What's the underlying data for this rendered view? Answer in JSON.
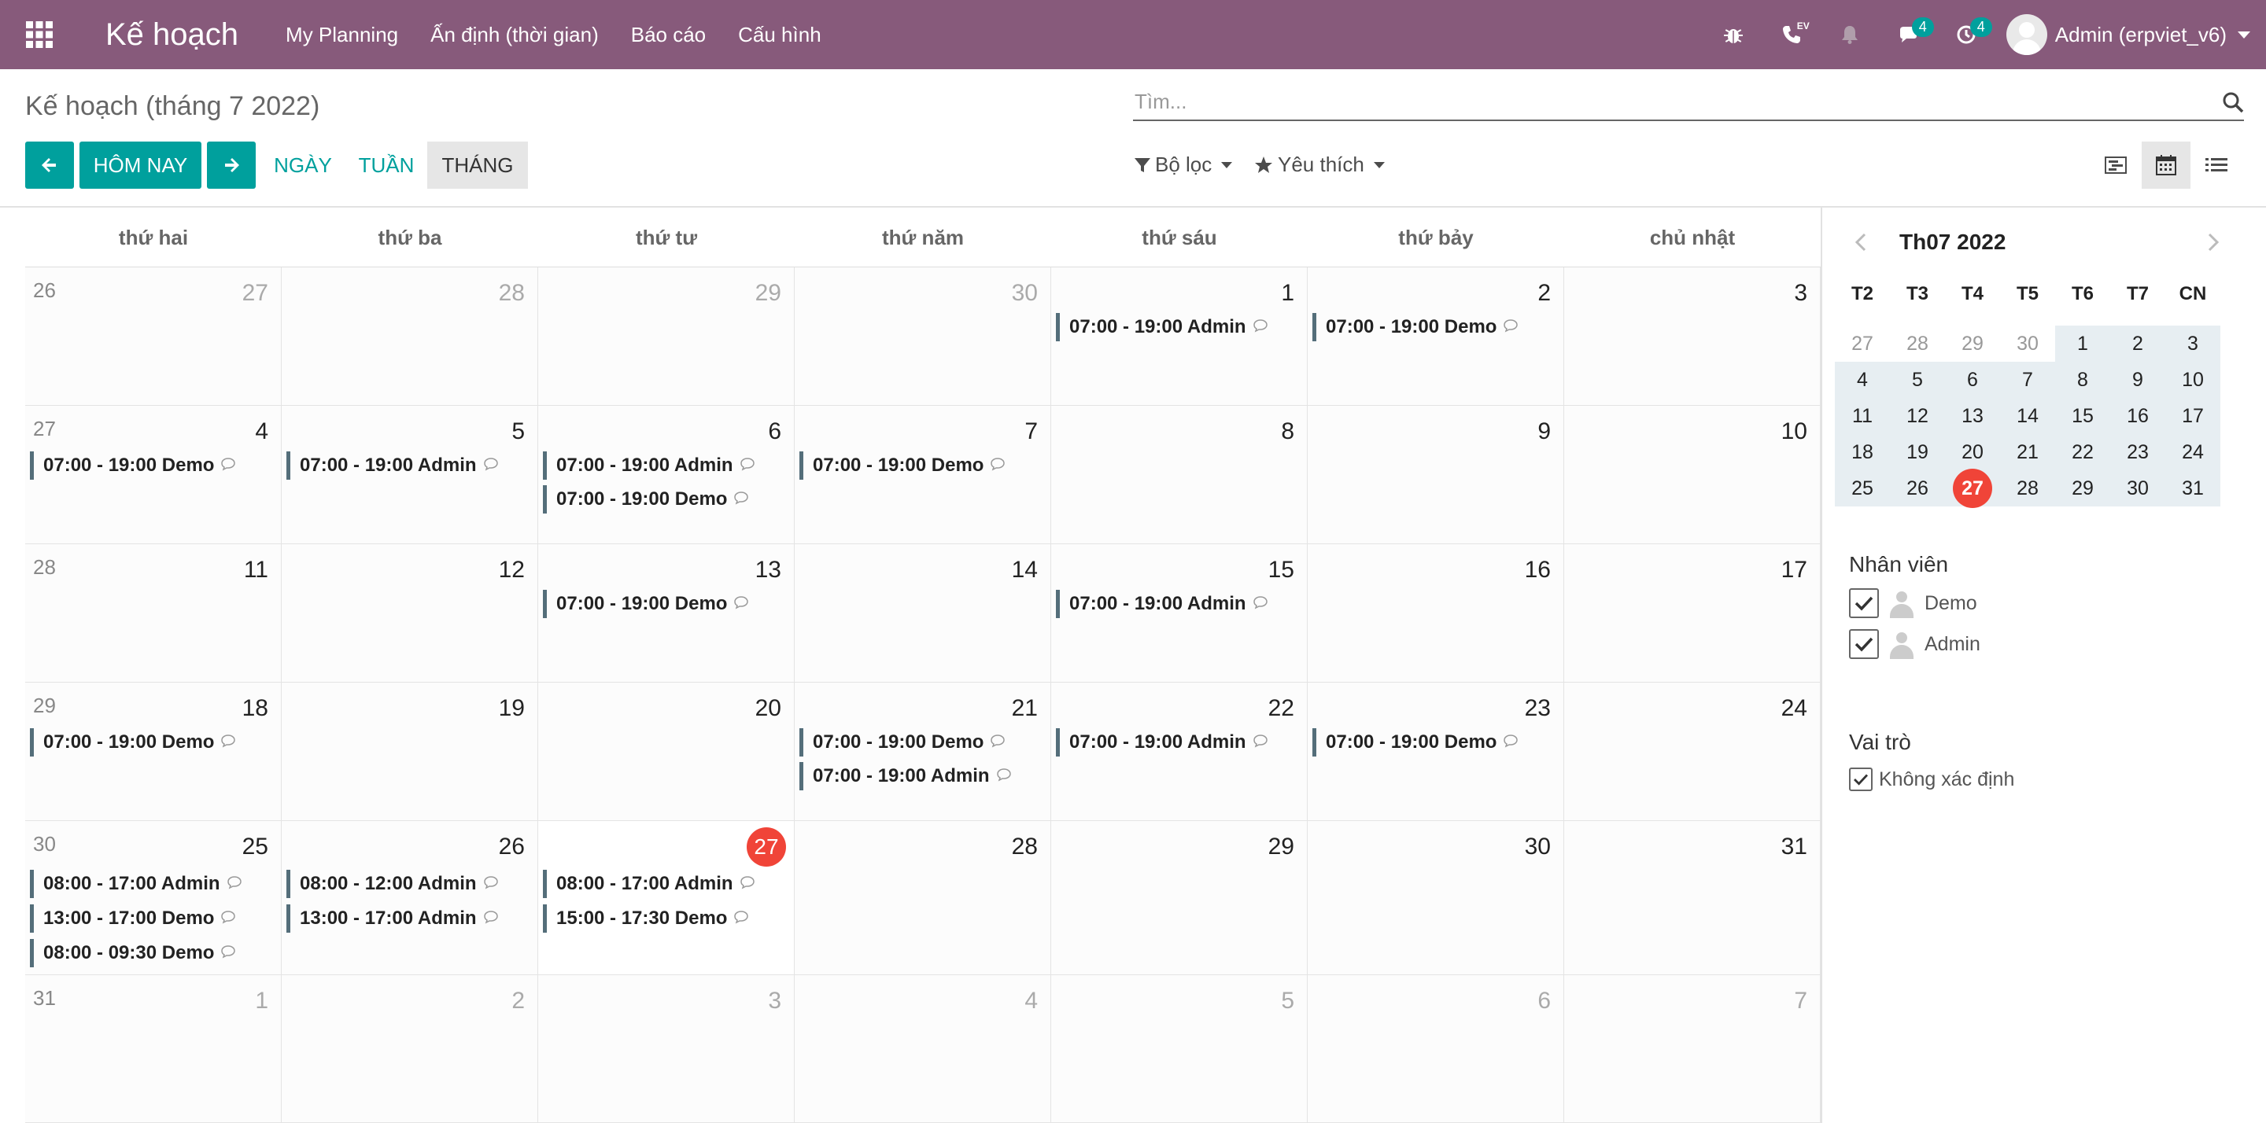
{
  "navbar": {
    "app_title": "Kế hoạch",
    "menu": [
      "My Planning",
      "Ấn định (thời gian)",
      "Báo cáo",
      "Cấu hình"
    ],
    "voip_label": "EV",
    "messages_count": "4",
    "activities_count": "4",
    "user_name": "Admin (erpviet_v6)"
  },
  "control": {
    "breadcrumb": "Kế hoạch (tháng 7 2022)",
    "search_placeholder": "Tìm...",
    "today_label": "HÔM NAY",
    "scale_day": "NGÀY",
    "scale_week": "TUẦN",
    "scale_month": "THÁNG",
    "filters_label": "Bộ lọc",
    "favorites_label": "Yêu thích"
  },
  "calendar": {
    "day_names": [
      "thứ hai",
      "thứ ba",
      "thứ tư",
      "thứ năm",
      "thứ sáu",
      "thứ bảy",
      "chủ nhật"
    ],
    "weeks": [
      {
        "week": "26",
        "days": [
          {
            "n": "27",
            "other": true,
            "events": []
          },
          {
            "n": "28",
            "other": true,
            "events": []
          },
          {
            "n": "29",
            "other": true,
            "events": []
          },
          {
            "n": "30",
            "other": true,
            "events": []
          },
          {
            "n": "1",
            "events": [
              "07:00 - 19:00 Admin"
            ]
          },
          {
            "n": "2",
            "events": [
              "07:00 - 19:00 Demo"
            ]
          },
          {
            "n": "3",
            "events": []
          }
        ]
      },
      {
        "week": "27",
        "days": [
          {
            "n": "4",
            "events": [
              "07:00 - 19:00 Demo"
            ]
          },
          {
            "n": "5",
            "events": [
              "07:00 - 19:00 Admin"
            ]
          },
          {
            "n": "6",
            "events": [
              "07:00 - 19:00 Admin",
              "07:00 - 19:00 Demo"
            ]
          },
          {
            "n": "7",
            "events": [
              "07:00 - 19:00 Demo"
            ]
          },
          {
            "n": "8",
            "events": []
          },
          {
            "n": "9",
            "events": []
          },
          {
            "n": "10",
            "events": []
          }
        ]
      },
      {
        "week": "28",
        "days": [
          {
            "n": "11",
            "events": []
          },
          {
            "n": "12",
            "events": []
          },
          {
            "n": "13",
            "events": [
              "07:00 - 19:00 Demo"
            ]
          },
          {
            "n": "14",
            "events": []
          },
          {
            "n": "15",
            "events": [
              "07:00 - 19:00 Admin"
            ]
          },
          {
            "n": "16",
            "events": []
          },
          {
            "n": "17",
            "events": []
          }
        ]
      },
      {
        "week": "29",
        "days": [
          {
            "n": "18",
            "events": [
              "07:00 - 19:00 Demo"
            ]
          },
          {
            "n": "19",
            "events": []
          },
          {
            "n": "20",
            "events": []
          },
          {
            "n": "21",
            "events": [
              "07:00 - 19:00 Demo",
              "07:00 - 19:00 Admin"
            ]
          },
          {
            "n": "22",
            "events": [
              "07:00 - 19:00 Admin"
            ]
          },
          {
            "n": "23",
            "events": [
              "07:00 - 19:00 Demo"
            ]
          },
          {
            "n": "24",
            "events": []
          }
        ]
      },
      {
        "week": "30",
        "days": [
          {
            "n": "25",
            "events": [
              "08:00 - 17:00 Admin",
              "13:00 - 17:00 Demo",
              "08:00 - 09:30 Demo"
            ]
          },
          {
            "n": "26",
            "events": [
              "08:00 - 12:00 Admin",
              "13:00 - 17:00 Admin"
            ]
          },
          {
            "n": "27",
            "today": true,
            "events": [
              "08:00 - 17:00 Admin",
              "15:00 - 17:30 Demo"
            ]
          },
          {
            "n": "28",
            "events": []
          },
          {
            "n": "29",
            "events": []
          },
          {
            "n": "30",
            "events": []
          },
          {
            "n": "31",
            "events": []
          }
        ]
      },
      {
        "week": "31",
        "days": [
          {
            "n": "1",
            "other": true,
            "events": []
          },
          {
            "n": "2",
            "other": true,
            "events": []
          },
          {
            "n": "3",
            "other": true,
            "events": []
          },
          {
            "n": "4",
            "other": true,
            "events": []
          },
          {
            "n": "5",
            "other": true,
            "events": []
          },
          {
            "n": "6",
            "other": true,
            "events": []
          },
          {
            "n": "7",
            "other": true,
            "events": []
          }
        ]
      }
    ]
  },
  "sidebar": {
    "mini_title": "Th07 2022",
    "mini_heads": [
      "T2",
      "T3",
      "T4",
      "T5",
      "T6",
      "T7",
      "CN"
    ],
    "mini_weeks": [
      [
        "27",
        "28",
        "29",
        "30",
        "1",
        "2",
        "3"
      ],
      [
        "4",
        "5",
        "6",
        "7",
        "8",
        "9",
        "10"
      ],
      [
        "11",
        "12",
        "13",
        "14",
        "15",
        "16",
        "17"
      ],
      [
        "18",
        "19",
        "20",
        "21",
        "22",
        "23",
        "24"
      ],
      [
        "25",
        "26",
        "27",
        "28",
        "29",
        "30",
        "31"
      ]
    ],
    "employees_title": "Nhân viên",
    "employees": [
      "Demo",
      "Admin"
    ],
    "roles_title": "Vai trò",
    "roles": [
      "Không xác định"
    ]
  },
  "colors": {
    "brand": "#875a7b",
    "primary": "#00a09d",
    "today": "#f04438",
    "event_bar": "#546e7a"
  }
}
